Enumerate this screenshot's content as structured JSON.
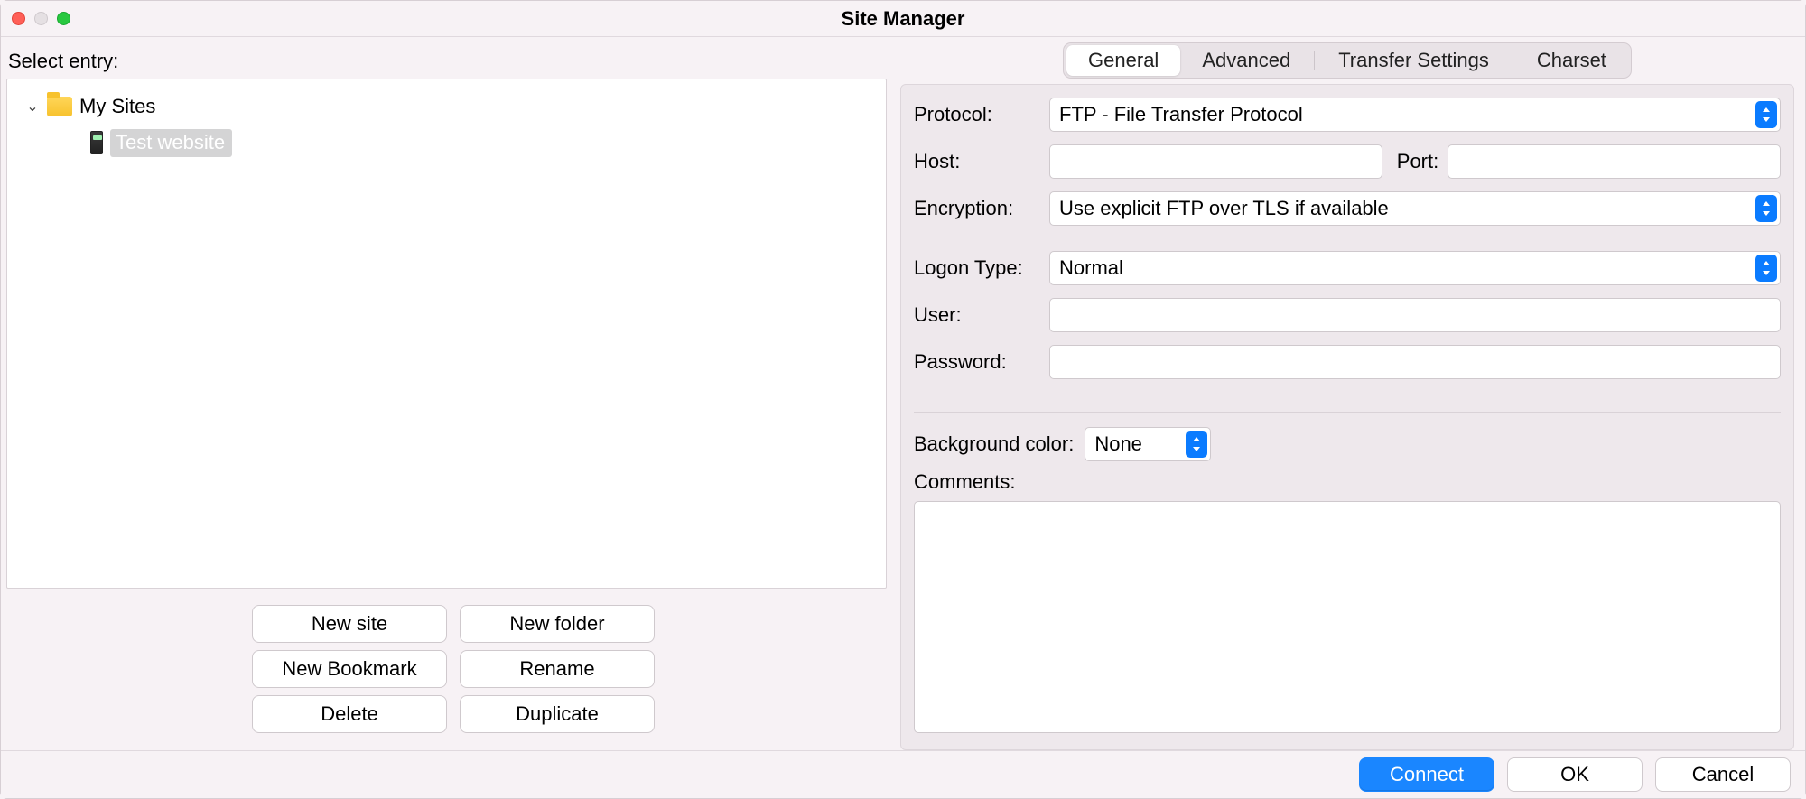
{
  "window": {
    "title": "Site Manager"
  },
  "left": {
    "select_entry_label": "Select entry:",
    "root_label": "My Sites",
    "selected_site_label": "Test website",
    "buttons": {
      "new_site": "New site",
      "new_folder": "New folder",
      "new_bookmark": "New Bookmark",
      "rename": "Rename",
      "delete": "Delete",
      "duplicate": "Duplicate"
    }
  },
  "tabs": {
    "general": "General",
    "advanced": "Advanced",
    "transfer": "Transfer Settings",
    "charset": "Charset"
  },
  "form": {
    "protocol_label": "Protocol:",
    "protocol_value": "FTP - File Transfer Protocol",
    "host_label": "Host:",
    "host_value": "",
    "port_label": "Port:",
    "port_value": "",
    "encryption_label": "Encryption:",
    "encryption_value": "Use explicit FTP over TLS if available",
    "logon_label": "Logon Type:",
    "logon_value": "Normal",
    "user_label": "User:",
    "user_value": "",
    "password_label": "Password:",
    "password_value": "",
    "bgcolor_label": "Background color:",
    "bgcolor_value": "None",
    "comments_label": "Comments:",
    "comments_value": ""
  },
  "footer": {
    "connect": "Connect",
    "ok": "OK",
    "cancel": "Cancel"
  }
}
